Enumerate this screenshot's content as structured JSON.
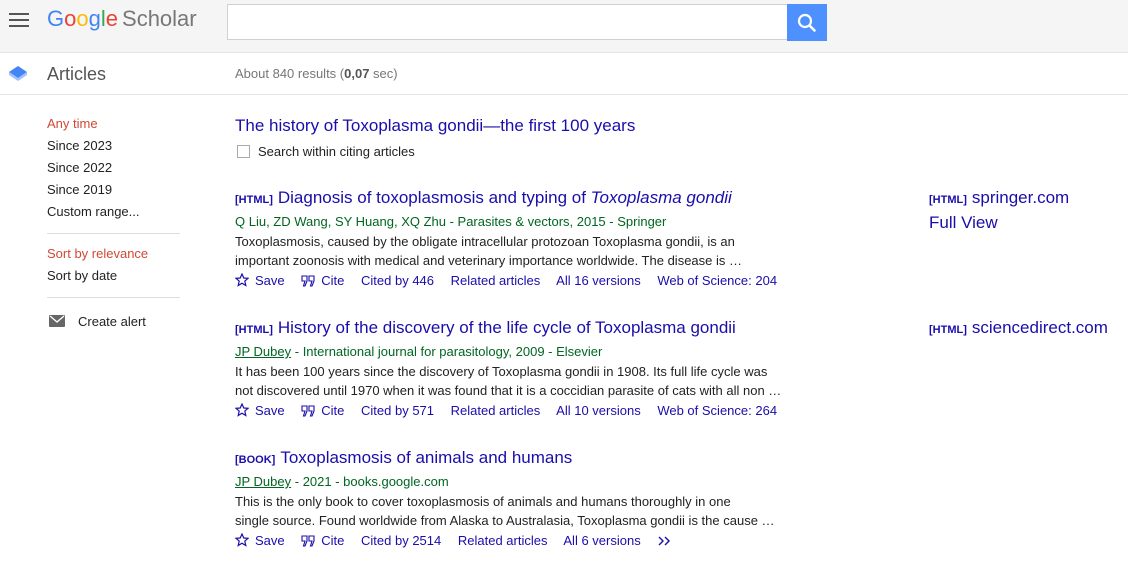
{
  "header": {
    "logo_letters": [
      "G",
      "o",
      "o",
      "g",
      "l",
      "e"
    ],
    "logo_product": "Scholar",
    "search_value": ""
  },
  "subbar": {
    "section": "Articles",
    "results_prefix": "About 840 results (",
    "results_time": "0,07",
    "results_suffix": " sec)"
  },
  "sidebar": {
    "time_filters": [
      "Any time",
      "Since 2023",
      "Since 2022",
      "Since 2019",
      "Custom range..."
    ],
    "sort": [
      "Sort by relevance",
      "Sort by date"
    ],
    "create_alert": "Create alert"
  },
  "query": {
    "title": "The history of Toxoplasma gondii—the first 100 years",
    "search_within": "Search within citing articles"
  },
  "results": [
    {
      "type": "[HTML]",
      "title_pre": "Diagnosis of toxoplasmosis and typing of ",
      "title_italic": "Toxoplasma gondii",
      "authors_link": "",
      "authors": "Q Liu, ZD Wang, SY Huang, XQ Zhu - Parasites & vectors, 2015 - Springer",
      "snippet_1": "Toxoplasmosis, caused by the obligate intracellular protozoan Toxoplasma gondii, is an",
      "snippet_2": "important zoonosis with medical and veterinary importance worldwide. The disease is …",
      "save": "Save",
      "cite": "Cite",
      "cited_by": "Cited by 446",
      "related": "Related articles",
      "versions": "All 16 versions",
      "wos": "Web of Science: 204",
      "side_type": "[HTML]",
      "side_source": "springer.com",
      "side_extra": "Full View"
    },
    {
      "type": "[HTML]",
      "title_pre": "History of the discovery of the life cycle of Toxoplasma gondii",
      "title_italic": "",
      "authors_link": "JP Dubey",
      "authors": " - International journal for parasitology, 2009 - Elsevier",
      "snippet_1": "It has been 100 years since the discovery of Toxoplasma gondii in 1908. Its full life cycle was",
      "snippet_2": "not discovered until 1970 when it was found that it is a coccidian parasite of cats with all non …",
      "save": "Save",
      "cite": "Cite",
      "cited_by": "Cited by 571",
      "related": "Related articles",
      "versions": "All 10 versions",
      "wos": "Web of Science: 264",
      "side_type": "[HTML]",
      "side_source": "sciencedirect.com",
      "side_extra": ""
    },
    {
      "type": "[BOOK]",
      "title_pre": "Toxoplasmosis of animals and humans",
      "title_italic": "",
      "authors_link": "JP Dubey",
      "authors": " - 2021 - books.google.com",
      "snippet_1": "This is the only book to cover toxoplasmosis of animals and humans thoroughly in one",
      "snippet_2": "single source. Found worldwide from Alaska to Australasia, Toxoplasma gondii is the cause …",
      "save": "Save",
      "cite": "Cite",
      "cited_by": "Cited by 2514",
      "related": "Related articles",
      "versions": "All 6 versions",
      "wos": "",
      "side_type": "",
      "side_source": "",
      "side_extra": ""
    }
  ],
  "icons": {
    "menu": "hamburger-menu-icon",
    "search": "search-icon",
    "articles": "articles-icon",
    "mail": "mail-icon",
    "star": "star-icon",
    "quote": "quote-icon",
    "more": "double-chevron-icon"
  },
  "colors": {
    "link": "#1a0dab",
    "author_green": "#006621",
    "active_red": "#d14836",
    "search_blue": "#4d90fe"
  }
}
